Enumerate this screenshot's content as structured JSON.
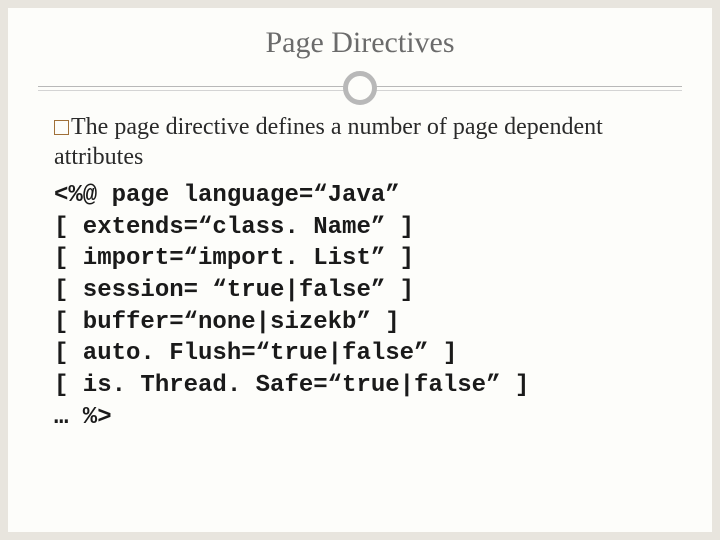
{
  "title": "Page Directives",
  "intro": "The page directive defines a number of page dependent attributes",
  "code": {
    "l1": "<%@ page language=“Java”",
    "l2": "[ extends=“class. Name” ]",
    "l3": "[ import=“import. List” ]",
    "l4": "[ session= “true|false” ]",
    "l5": "[ buffer=“none|sizekb” ]",
    "l6": "[ auto. Flush=“true|false” ]",
    "l7": "[ is. Thread. Safe=“true|false” ]",
    "l8": "… %>"
  }
}
